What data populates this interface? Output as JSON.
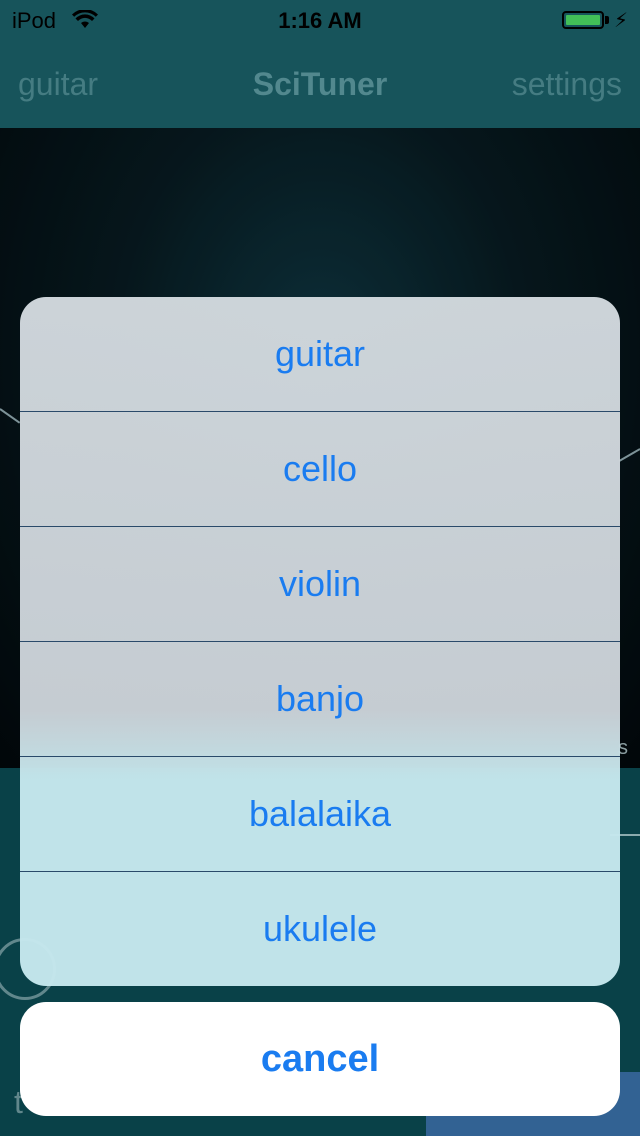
{
  "status_bar": {
    "carrier": "iPod",
    "time": "1:16 AM",
    "battery_level": 1.0,
    "battery_color": "#4cd964",
    "wifi_icon": "wifi-icon",
    "charging_icon": "bolt-icon"
  },
  "nav": {
    "left": "guitar",
    "title": "SciTuner",
    "right": "settings"
  },
  "background": {
    "corner_text": "s",
    "bottom_fragment": "t"
  },
  "action_sheet": {
    "items": [
      {
        "label": "guitar"
      },
      {
        "label": "cello"
      },
      {
        "label": "violin"
      },
      {
        "label": "banjo"
      },
      {
        "label": "balalaika"
      },
      {
        "label": "ukulele"
      }
    ],
    "cancel_label": "cancel"
  },
  "colors": {
    "accent": "#1a7cf0",
    "nav_bg": "#1b6068",
    "app_bg": "#0b4a52"
  }
}
